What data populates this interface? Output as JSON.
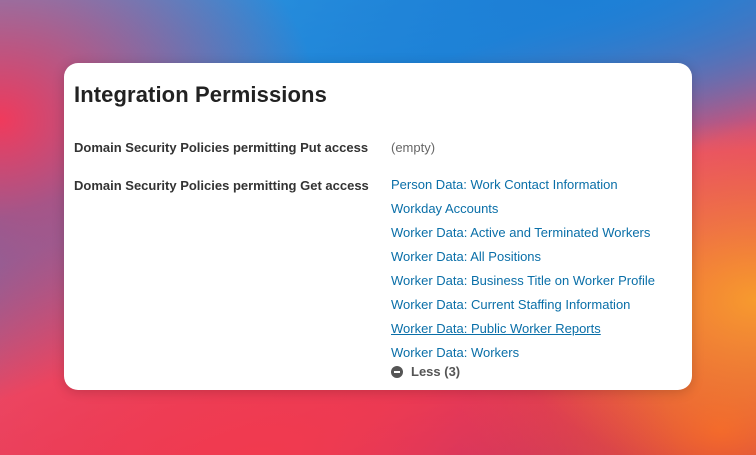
{
  "panel": {
    "title": "Integration Permissions"
  },
  "put_access": {
    "label": "Domain Security Policies permitting Put access",
    "value": "(empty)"
  },
  "get_access": {
    "label": "Domain Security Policies permitting Get access",
    "items": [
      "Person Data: Work Contact Information",
      "Workday Accounts",
      "Worker Data: Active and Terminated Workers",
      "Worker Data: All Positions",
      "Worker Data: Business Title on Worker Profile",
      "Worker Data: Current Staffing Information",
      "Worker Data: Public Worker Reports",
      "Worker Data: Workers"
    ],
    "hovered_item": "Worker Data: Public Worker Reports",
    "toggle_label": "Less (3)",
    "toggle_icon": "minus-circle-icon"
  },
  "colors": {
    "link": "#0a6fa8",
    "title": "#222222",
    "label": "#333333",
    "muted": "#666666"
  }
}
